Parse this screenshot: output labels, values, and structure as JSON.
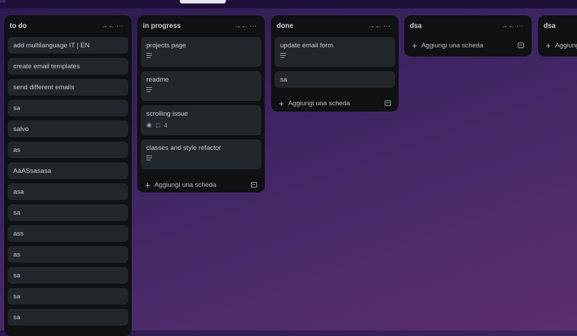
{
  "lists": [
    {
      "title": "to do",
      "cards": [
        "add multilanguage IT | EN",
        "create email templates",
        "send different emails",
        "sa",
        "salvo",
        "as",
        "AaASsasasa",
        "asa",
        "sa",
        "ass",
        "as",
        "sa",
        "sa",
        "sa"
      ]
    },
    {
      "title": "in progress",
      "cards": [
        {
          "title": "projects page",
          "badge": "description"
        },
        {
          "title": "readme",
          "badge": "description"
        },
        {
          "title": "scrolling issue",
          "badge": "watch",
          "comments": "4"
        },
        {
          "title": "classes and style refactor",
          "badge": "description"
        }
      ],
      "add_label": "Aggiungi una scheda"
    },
    {
      "title": "done",
      "cards": [
        {
          "title": "update email form",
          "badge": "description"
        },
        {
          "title": "sa"
        }
      ],
      "add_label": "Aggiungi una scheda"
    },
    {
      "title": "dsa",
      "add_label": "Aggiungi una scheda"
    },
    {
      "title": "dsa",
      "add_label": "Aggiungi una scheda"
    }
  ],
  "icons": {
    "collapse": "collapse-icon",
    "more": "more-icon",
    "plus": "plus-icon",
    "template": "template-icon",
    "description": "description-icon",
    "watch": "eye-icon",
    "comment": "comment-icon"
  }
}
